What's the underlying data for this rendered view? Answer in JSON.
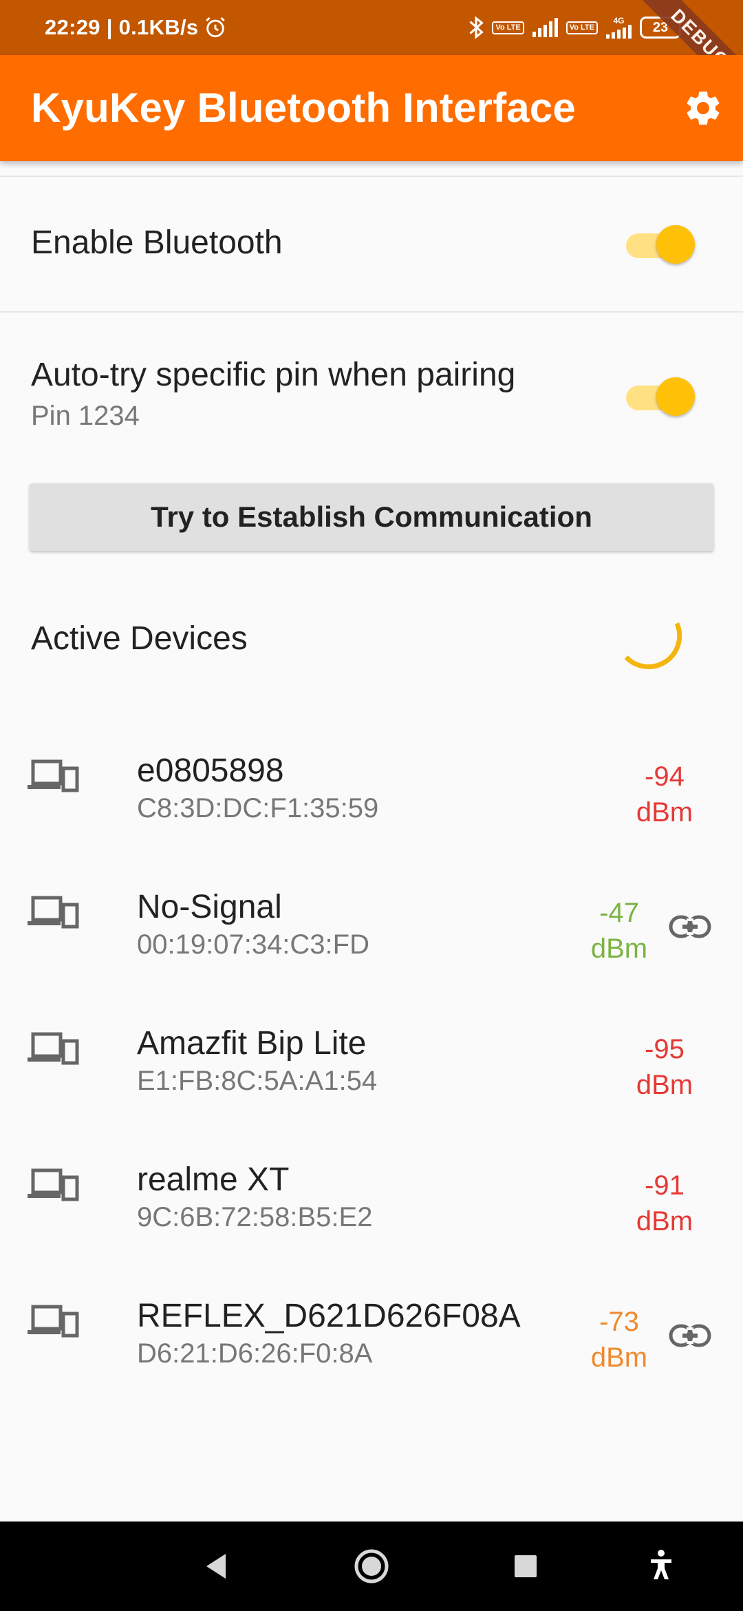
{
  "status_bar": {
    "time_speed": "22:29 | 0.1KB/s",
    "volte_label": "Vo LTE",
    "network_label": "4G",
    "battery": "23",
    "debug_banner": "DEBUG"
  },
  "app_bar": {
    "title": "KyuKey Bluetooth Interface",
    "settings_icon": "gear-icon"
  },
  "bluetooth_toggle": {
    "label": "Enable Bluetooth",
    "enabled": true
  },
  "pin_toggle": {
    "label": "Auto-try specific pin when pairing",
    "sublabel": "Pin 1234",
    "enabled": true
  },
  "communication_button": {
    "label": "Try to Establish Communication"
  },
  "active_devices": {
    "title": "Active Devices",
    "loading": true,
    "devices": [
      {
        "name": "e0805898",
        "mac": "C8:3D:DC:F1:35:59",
        "rssi": "-94",
        "unit": "dBm",
        "color": "#e53935",
        "linked": false
      },
      {
        "name": "No-Signal",
        "mac": "00:19:07:34:C3:FD",
        "rssi": "-47",
        "unit": "dBm",
        "color": "#7cb342",
        "linked": true
      },
      {
        "name": "Amazfit Bip Lite",
        "mac": "E1:FB:8C:5A:A1:54",
        "rssi": "-95",
        "unit": "dBm",
        "color": "#e53935",
        "linked": false
      },
      {
        "name": "realme XT",
        "mac": "9C:6B:72:58:B5:E2",
        "rssi": "-91",
        "unit": "dBm",
        "color": "#e53935",
        "linked": false
      },
      {
        "name": "REFLEX_D621D626F08A",
        "mac": "D6:21:D6:26:F0:8A",
        "rssi": "-73",
        "unit": "dBm",
        "color": "#ef8a2e",
        "linked": true
      }
    ]
  },
  "colors": {
    "app_bar": "#ff6d00",
    "status_bar": "#c25700",
    "accent": "#ffc107",
    "signal_weak": "#e53935",
    "signal_strong": "#7cb342",
    "signal_medium": "#ef8a2e"
  },
  "nav_bar": {
    "back_icon": "back-triangle-icon",
    "home_icon": "home-circle-icon",
    "recents_icon": "recents-square-icon",
    "accessibility_icon": "accessibility-icon"
  }
}
